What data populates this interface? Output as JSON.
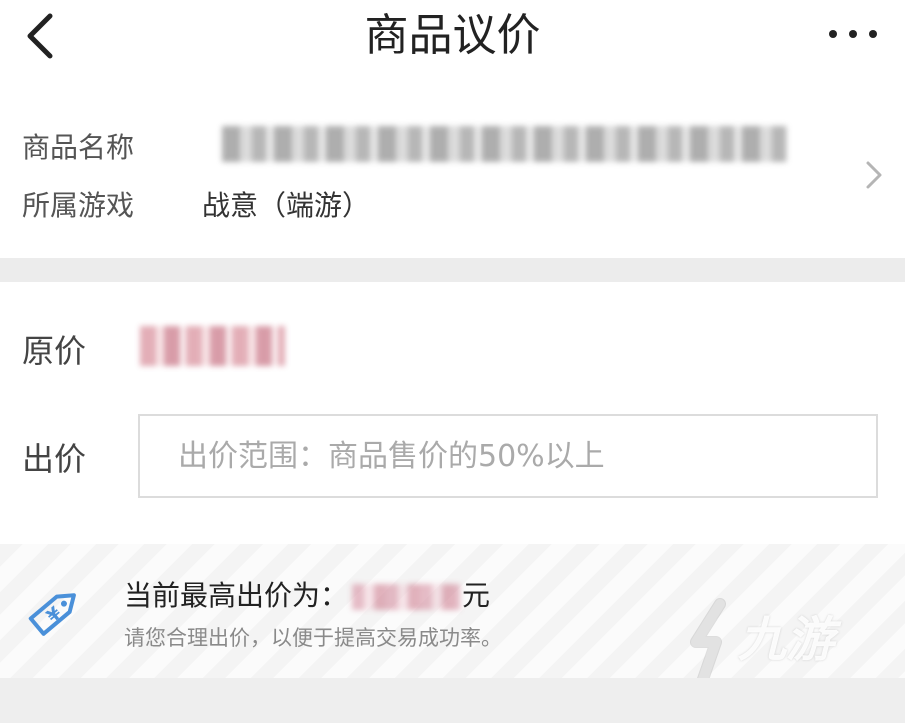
{
  "header": {
    "title": "商品议价"
  },
  "product_info": {
    "name_label": "商品名称",
    "game_label": "所属游戏",
    "game_value": "战意（端游）"
  },
  "pricing": {
    "original_price_label": "原价",
    "bid_label": "出价",
    "bid_value": "",
    "bid_placeholder": "出价范围：商品售价的50%以上"
  },
  "tip": {
    "current_highest_prefix": "当前最高出价为：",
    "currency_suffix": "元",
    "advice": "请您合理出价，以便于提高交易成功率。",
    "tag_symbol": "¥"
  },
  "watermark": {
    "text": "九游"
  },
  "icons": {
    "back": "chevron-left-icon",
    "more": "more-dots-icon",
    "detail": "chevron-right-icon",
    "tag": "price-tag-icon"
  },
  "colors": {
    "background": "#ffffff",
    "separator": "#ececec",
    "tag_icon": "#4a90d9",
    "muted_text": "#8a8a8a",
    "placeholder": "#aaaaaa"
  }
}
